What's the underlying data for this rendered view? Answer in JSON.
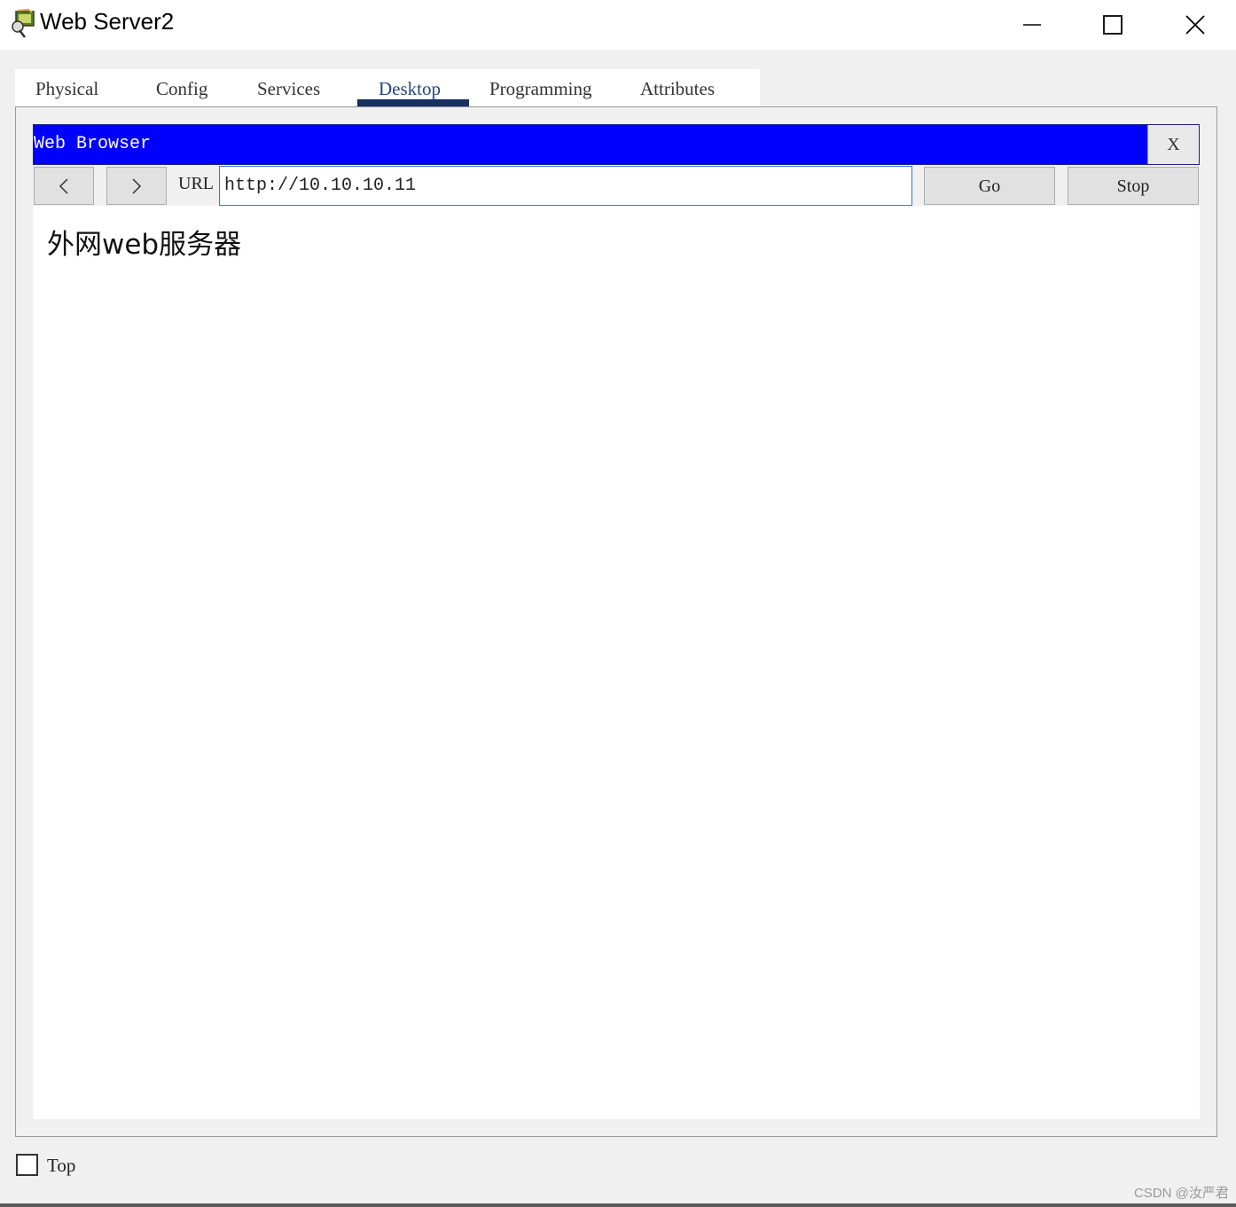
{
  "window": {
    "title": "Web Server2",
    "icon": "packet-tracer-server-icon"
  },
  "tabs": [
    {
      "label": "Physical"
    },
    {
      "label": "Config"
    },
    {
      "label": "Services"
    },
    {
      "label": "Desktop",
      "active": true
    },
    {
      "label": "Programming"
    },
    {
      "label": "Attributes"
    }
  ],
  "browser": {
    "title": "Web Browser",
    "close_label": "X",
    "url_label": "URL",
    "url_value": "http://10.10.10.11",
    "go_label": "Go",
    "stop_label": "Stop",
    "page_heading": "外网web服务器"
  },
  "footer": {
    "top_label": "Top",
    "top_checked": false
  },
  "watermark": "CSDN @汝严君",
  "colors": {
    "browser_header": "#0000ff",
    "active_tab_underline": "#173060",
    "url_border": "#3d78c4"
  }
}
